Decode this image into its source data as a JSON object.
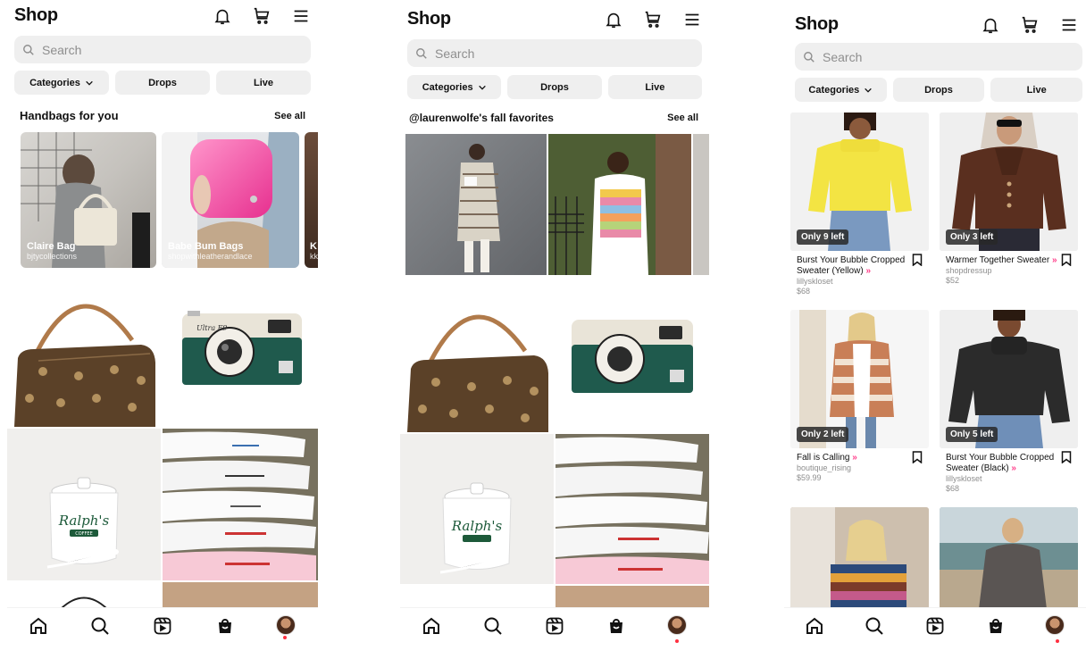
{
  "header": {
    "title": "Shop"
  },
  "search": {
    "placeholder": "Search"
  },
  "chips": {
    "categories": "Categories",
    "drops": "Drops",
    "live": "Live"
  },
  "screen1": {
    "section_title": "Handbags for you",
    "see_all": "See all",
    "cards": [
      {
        "name": "Claire Bag",
        "seller": "bjtycollections"
      },
      {
        "name": "Babe Bum Bags",
        "seller": "shopwithleatherandlace"
      },
      {
        "name": "K",
        "seller": "kk"
      }
    ]
  },
  "screen2": {
    "section_title": "@laurenwolfe's fall favorites",
    "see_all": "See all"
  },
  "screen3": {
    "products": [
      {
        "badge": "Only 9 left",
        "title": "Burst Your Bubble Cropped Sweater (Yellow)",
        "seller": "lillyskloset",
        "price": "$68"
      },
      {
        "badge": "Only 3 left",
        "title": "Warmer Together Sweater",
        "seller": "shopdressup",
        "price": "$52"
      },
      {
        "badge": "Only 2 left",
        "title": "Fall is Calling",
        "seller": "boutique_rising",
        "price": "$59.99"
      },
      {
        "badge": "Only 5 left",
        "title": "Burst Your Bubble Cropped Sweater (Black)",
        "seller": "lillyskloset",
        "price": "$68"
      }
    ]
  },
  "icons": {
    "header": [
      "bell-icon",
      "cart-icon",
      "menu-icon"
    ],
    "nav": [
      "home-icon",
      "search-icon",
      "reels-icon",
      "shop-icon",
      "profile-avatar"
    ]
  },
  "colors": {
    "accent_pink": "#ff3e8a",
    "notification_dot": "#ff3040",
    "chip_bg": "#efefef"
  },
  "product_glyphs": {
    "camera_brand": "Ultra F9",
    "mug_brand": "Ralph's",
    "mug_sub": "COFFEE"
  }
}
